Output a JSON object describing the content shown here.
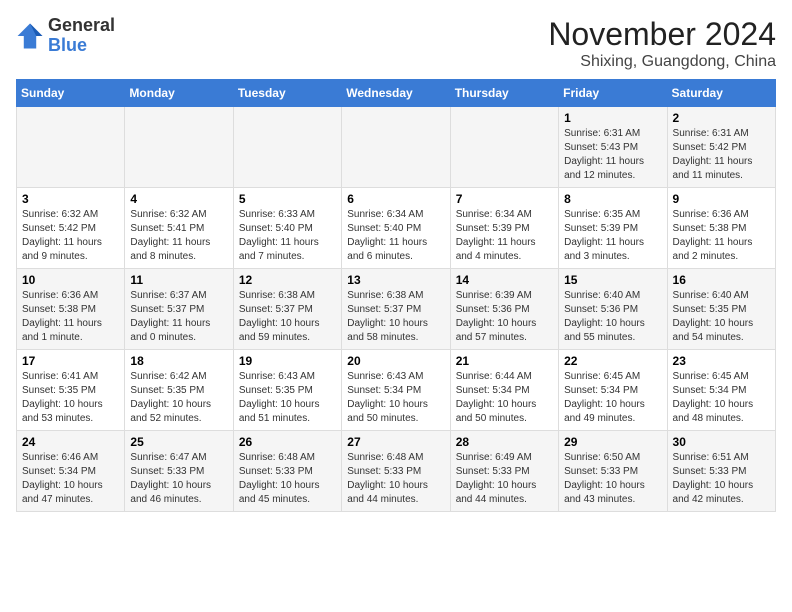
{
  "logo": {
    "general": "General",
    "blue": "Blue"
  },
  "header": {
    "month": "November 2024",
    "location": "Shixing, Guangdong, China"
  },
  "weekdays": [
    "Sunday",
    "Monday",
    "Tuesday",
    "Wednesday",
    "Thursday",
    "Friday",
    "Saturday"
  ],
  "weeks": [
    [
      {
        "day": "",
        "info": ""
      },
      {
        "day": "",
        "info": ""
      },
      {
        "day": "",
        "info": ""
      },
      {
        "day": "",
        "info": ""
      },
      {
        "day": "",
        "info": ""
      },
      {
        "day": "1",
        "info": "Sunrise: 6:31 AM\nSunset: 5:43 PM\nDaylight: 11 hours and 12 minutes."
      },
      {
        "day": "2",
        "info": "Sunrise: 6:31 AM\nSunset: 5:42 PM\nDaylight: 11 hours and 11 minutes."
      }
    ],
    [
      {
        "day": "3",
        "info": "Sunrise: 6:32 AM\nSunset: 5:42 PM\nDaylight: 11 hours and 9 minutes."
      },
      {
        "day": "4",
        "info": "Sunrise: 6:32 AM\nSunset: 5:41 PM\nDaylight: 11 hours and 8 minutes."
      },
      {
        "day": "5",
        "info": "Sunrise: 6:33 AM\nSunset: 5:40 PM\nDaylight: 11 hours and 7 minutes."
      },
      {
        "day": "6",
        "info": "Sunrise: 6:34 AM\nSunset: 5:40 PM\nDaylight: 11 hours and 6 minutes."
      },
      {
        "day": "7",
        "info": "Sunrise: 6:34 AM\nSunset: 5:39 PM\nDaylight: 11 hours and 4 minutes."
      },
      {
        "day": "8",
        "info": "Sunrise: 6:35 AM\nSunset: 5:39 PM\nDaylight: 11 hours and 3 minutes."
      },
      {
        "day": "9",
        "info": "Sunrise: 6:36 AM\nSunset: 5:38 PM\nDaylight: 11 hours and 2 minutes."
      }
    ],
    [
      {
        "day": "10",
        "info": "Sunrise: 6:36 AM\nSunset: 5:38 PM\nDaylight: 11 hours and 1 minute."
      },
      {
        "day": "11",
        "info": "Sunrise: 6:37 AM\nSunset: 5:37 PM\nDaylight: 11 hours and 0 minutes."
      },
      {
        "day": "12",
        "info": "Sunrise: 6:38 AM\nSunset: 5:37 PM\nDaylight: 10 hours and 59 minutes."
      },
      {
        "day": "13",
        "info": "Sunrise: 6:38 AM\nSunset: 5:37 PM\nDaylight: 10 hours and 58 minutes."
      },
      {
        "day": "14",
        "info": "Sunrise: 6:39 AM\nSunset: 5:36 PM\nDaylight: 10 hours and 57 minutes."
      },
      {
        "day": "15",
        "info": "Sunrise: 6:40 AM\nSunset: 5:36 PM\nDaylight: 10 hours and 55 minutes."
      },
      {
        "day": "16",
        "info": "Sunrise: 6:40 AM\nSunset: 5:35 PM\nDaylight: 10 hours and 54 minutes."
      }
    ],
    [
      {
        "day": "17",
        "info": "Sunrise: 6:41 AM\nSunset: 5:35 PM\nDaylight: 10 hours and 53 minutes."
      },
      {
        "day": "18",
        "info": "Sunrise: 6:42 AM\nSunset: 5:35 PM\nDaylight: 10 hours and 52 minutes."
      },
      {
        "day": "19",
        "info": "Sunrise: 6:43 AM\nSunset: 5:35 PM\nDaylight: 10 hours and 51 minutes."
      },
      {
        "day": "20",
        "info": "Sunrise: 6:43 AM\nSunset: 5:34 PM\nDaylight: 10 hours and 50 minutes."
      },
      {
        "day": "21",
        "info": "Sunrise: 6:44 AM\nSunset: 5:34 PM\nDaylight: 10 hours and 50 minutes."
      },
      {
        "day": "22",
        "info": "Sunrise: 6:45 AM\nSunset: 5:34 PM\nDaylight: 10 hours and 49 minutes."
      },
      {
        "day": "23",
        "info": "Sunrise: 6:45 AM\nSunset: 5:34 PM\nDaylight: 10 hours and 48 minutes."
      }
    ],
    [
      {
        "day": "24",
        "info": "Sunrise: 6:46 AM\nSunset: 5:34 PM\nDaylight: 10 hours and 47 minutes."
      },
      {
        "day": "25",
        "info": "Sunrise: 6:47 AM\nSunset: 5:33 PM\nDaylight: 10 hours and 46 minutes."
      },
      {
        "day": "26",
        "info": "Sunrise: 6:48 AM\nSunset: 5:33 PM\nDaylight: 10 hours and 45 minutes."
      },
      {
        "day": "27",
        "info": "Sunrise: 6:48 AM\nSunset: 5:33 PM\nDaylight: 10 hours and 44 minutes."
      },
      {
        "day": "28",
        "info": "Sunrise: 6:49 AM\nSunset: 5:33 PM\nDaylight: 10 hours and 44 minutes."
      },
      {
        "day": "29",
        "info": "Sunrise: 6:50 AM\nSunset: 5:33 PM\nDaylight: 10 hours and 43 minutes."
      },
      {
        "day": "30",
        "info": "Sunrise: 6:51 AM\nSunset: 5:33 PM\nDaylight: 10 hours and 42 minutes."
      }
    ]
  ]
}
